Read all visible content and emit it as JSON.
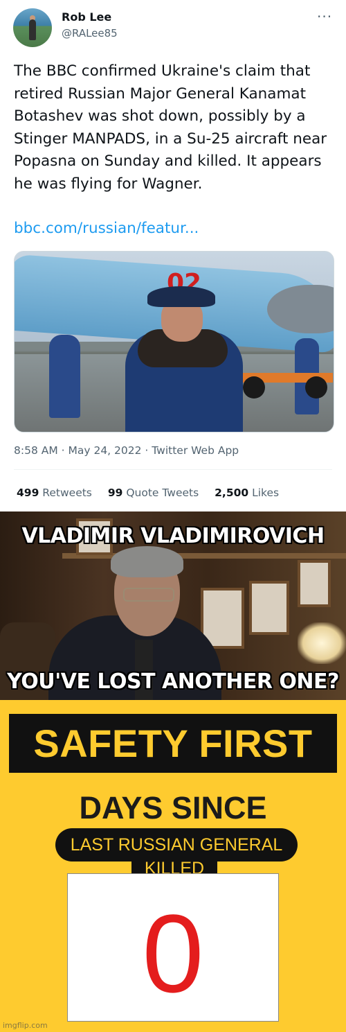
{
  "tweet": {
    "author_name": "Rob Lee",
    "handle": "@RALee85",
    "text": "The BBC confirmed Ukraine's claim that retired Russian Major General Kanamat Botashev was shot down, possibly by a Stinger MANPADS, in a Su-25 aircraft near Popasna on Sunday and killed. It appears he was flying for Wagner.",
    "link": "bbc.com/russian/featur...",
    "image_marking": "02",
    "timestamp": "8:58 AM · May 24, 2022 · Twitter Web App",
    "stats": {
      "retweets_count": "499",
      "retweets_label": "Retweets",
      "quotes_count": "99",
      "quotes_label": "Quote Tweets",
      "likes_count": "2,500",
      "likes_label": "Likes"
    }
  },
  "meme": {
    "top_text": "VLADIMIR VLADIMIROVICH",
    "bottom_text": "YOU'VE LOST ANOTHER ONE?"
  },
  "sign": {
    "banner": "SAFETY FIRST",
    "heading": "DAYS SINCE",
    "pill_text": "LAST RUSSIAN GENERAL",
    "tab_text": "KILLED",
    "counter_value": "0",
    "accent_color": "#fecb2f",
    "counter_color": "#e41d1d"
  },
  "watermark": "imgflip.com"
}
